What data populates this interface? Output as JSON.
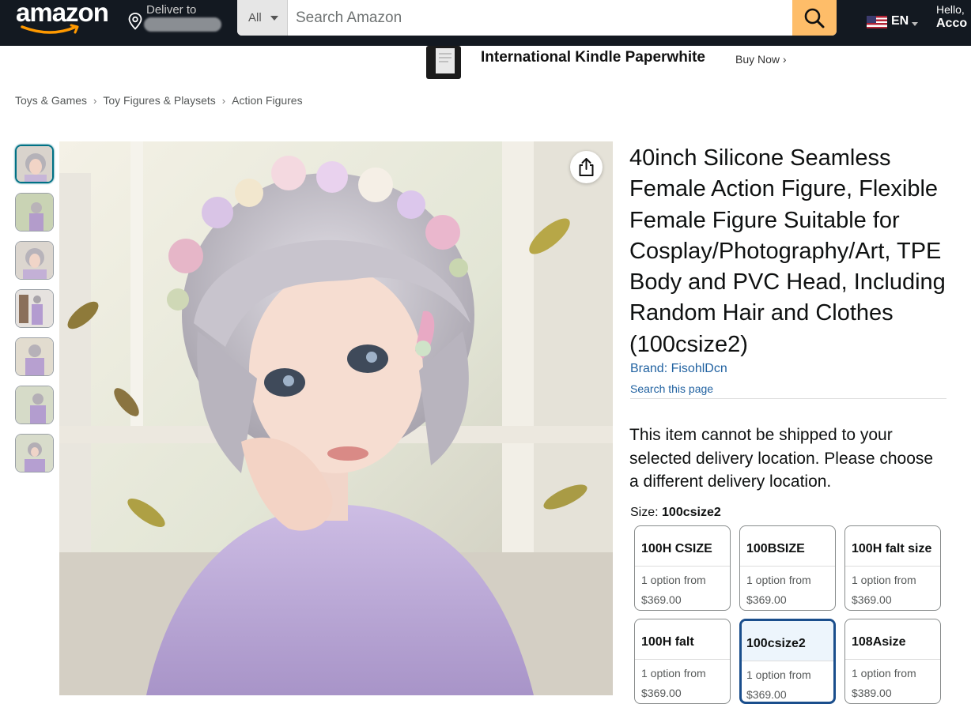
{
  "nav": {
    "logo_text": "amazon",
    "deliver_label": "Deliver to",
    "search_category": "All",
    "search_placeholder": "Search Amazon",
    "language": "EN",
    "account_greeting": "Hello,",
    "account_label": "Acco"
  },
  "banner": {
    "title": "International Kindle Paperwhite",
    "link": "Buy Now ›"
  },
  "breadcrumb": [
    "Toys & Games",
    "Toy Figures & Playsets",
    "Action Figures"
  ],
  "product": {
    "title": "40inch Silicone Seamless Female Action Figure, Flexible Female Figure Suitable for Cosplay/Photography/Art, TPE Body and PVC Head, Including Random Hair and Clothes (100csize2)",
    "brand": "Brand: FisohlDcn",
    "search_page": "Search this page",
    "shipping_message": "This item cannot be shipped to your selected delivery location. Please choose a different delivery location.",
    "size_label": "Size:",
    "size_selected": "100csize2",
    "thumbnail_count": 7,
    "size_options": [
      {
        "name": "100H CSIZE",
        "desc": "1 option from",
        "price": "$369.00",
        "selected": false
      },
      {
        "name": "100BSIZE",
        "desc": "1 option from",
        "price": "$369.00",
        "selected": false
      },
      {
        "name": "100H falt size",
        "desc": "1 option from",
        "price": "$369.00",
        "selected": false
      },
      {
        "name": "100H falt",
        "desc": "1 option from",
        "price": "$369.00",
        "selected": false
      },
      {
        "name": "100csize2",
        "desc": "1 option from",
        "price": "$369.00",
        "selected": true
      },
      {
        "name": "108Asize",
        "desc": "1 option from",
        "price": "$389.00",
        "selected": false
      }
    ]
  },
  "colors": {
    "nav_bg": "#131921",
    "search_button": "#febd69",
    "link": "#2162a1",
    "selected_border": "#1a4e8c"
  }
}
